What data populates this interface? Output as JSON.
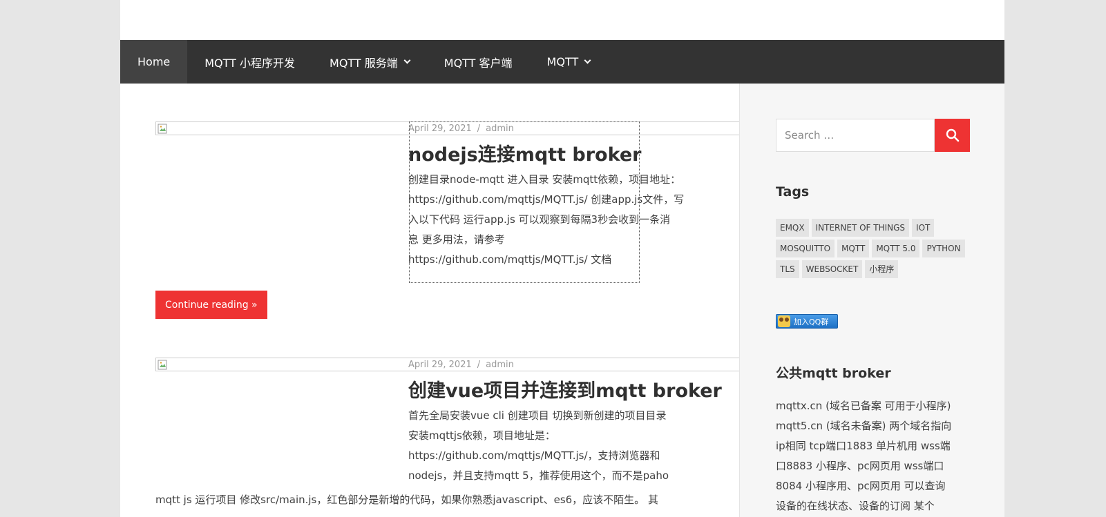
{
  "nav": {
    "items": [
      {
        "label": "Home"
      },
      {
        "label": "MQTT 小程序开发"
      },
      {
        "label": "MQTT 服务端"
      },
      {
        "label": "MQTT 客户端"
      },
      {
        "label": "MQTT"
      }
    ]
  },
  "posts": [
    {
      "date": "April 29, 2021",
      "separator": "/",
      "author": "admin",
      "title": "nodejs连接mqtt broker",
      "excerpt_lines": [
        "创建目录node-mqtt 进入目录 安装mqtt依赖，项目地址：",
        "https://github.com/mqttjs/MQTT.js/ 创建app.js文件，写",
        "入以下代码 运行app.js 可以观察到每隔3秒会收到一条消",
        "息 更多用法，请参考",
        "https://github.com/mqttjs/MQTT.js/ 文档"
      ],
      "continue_label": "Continue reading »"
    },
    {
      "date": "April 29, 2021",
      "separator": "/",
      "author": "admin",
      "title": "创建vue项目并连接到mqtt broker",
      "excerpt_lines": [
        "首先全局安装vue cli 创建项目 切换到新创建的项目目录",
        "安装mqttjs依赖，项目地址是：",
        "https://github.com/mqttjs/MQTT.js/，支持浏览器和",
        "nodejs，并且支持mqtt 5，推荐使用这个，而不是paho"
      ],
      "excerpt_full_line": "mqtt js 运行项目 修改src/main.js，红色部分是新增的代码，如果你熟悉javascript、es6，应该不陌生。 其"
    }
  ],
  "sidebar": {
    "search": {
      "placeholder": "Search …"
    },
    "tags_title": "Tags",
    "tags": [
      "EMQX",
      "INTERNET OF THINGS",
      "IOT",
      "MOSQUITTO",
      "MQTT",
      "MQTT 5.0",
      "PYTHON",
      "TLS",
      "WEBSOCKET",
      "小程序"
    ],
    "qq_label": "加入QQ群",
    "broker_title": "公共mqtt broker",
    "broker_lines": [
      "mqttx.cn (域名已备案 可用于小程序)",
      "mqtt5.cn (域名未备案) 两个域名指向",
      "ip相同 tcp端口1883 单片机用 wss端",
      "口8883 小程序、pc网页用 wss端口",
      "8084 小程序用、pc网页用 可以查询",
      "设备的在线状态、设备的订阅 某个"
    ]
  },
  "colors": {
    "accent": "#ee3333",
    "nav_bg": "#333333",
    "nav_active": "#424242"
  }
}
